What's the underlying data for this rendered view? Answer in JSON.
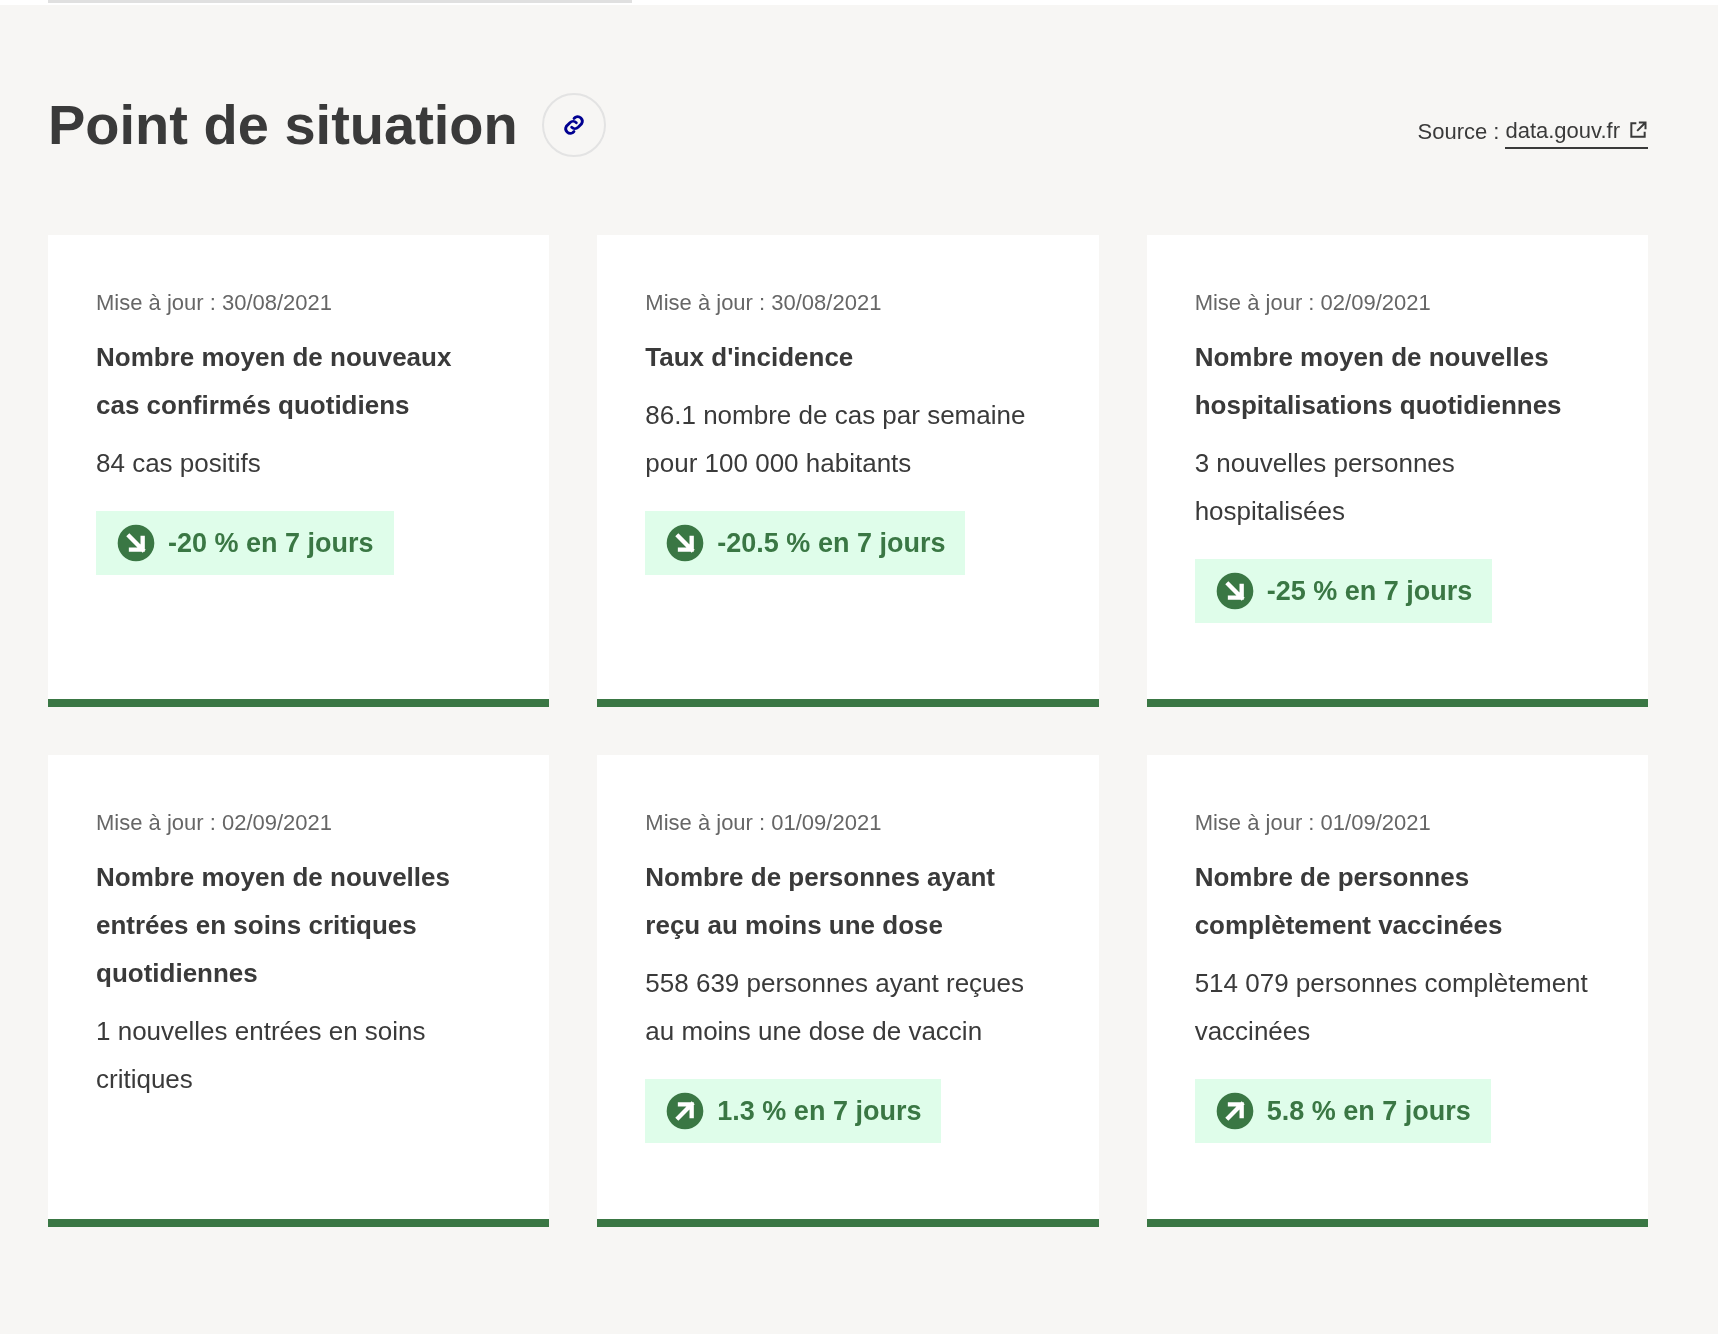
{
  "header": {
    "title": "Point de situation",
    "source_label": "Source :",
    "source_link": "data.gouv.fr"
  },
  "cards": [
    {
      "updated": "Mise à jour : 30/08/2021",
      "title": "Nombre moyen de nouveaux cas confirmés quotidiens",
      "value": "84 cas positifs",
      "trend": {
        "kind": "down",
        "text": "-20 % en 7 jours"
      }
    },
    {
      "updated": "Mise à jour : 30/08/2021",
      "title": "Taux d'incidence",
      "value": "86.1 nombre de cas par semaine pour 100 000 habitants",
      "trend": {
        "kind": "down",
        "text": "-20.5 % en 7 jours"
      }
    },
    {
      "updated": "Mise à jour : 02/09/2021",
      "title": "Nombre moyen de nouvelles hospitalisations quotidiennes",
      "value": "3 nouvelles personnes hospitalisées",
      "trend": {
        "kind": "down",
        "text": "-25 % en 7 jours"
      }
    },
    {
      "updated": "Mise à jour : 02/09/2021",
      "title": "Nombre moyen de nouvelles entrées en soins critiques quotidiennes",
      "value": "1 nouvelles entrées en soins critiques"
    },
    {
      "updated": "Mise à jour : 01/09/2021",
      "title": "Nombre de personnes ayant reçu au moins une dose",
      "value": "558 639 personnes ayant reçues au moins une dose de vaccin",
      "trend": {
        "kind": "up",
        "text": "1.3 % en 7 jours"
      }
    },
    {
      "updated": "Mise à jour : 01/09/2021",
      "title": "Nombre de personnes complètement vaccinées",
      "value": "514 079 personnes complètement vaccinées",
      "trend": {
        "kind": "up",
        "text": "5.8 % en 7 jours"
      }
    }
  ]
}
